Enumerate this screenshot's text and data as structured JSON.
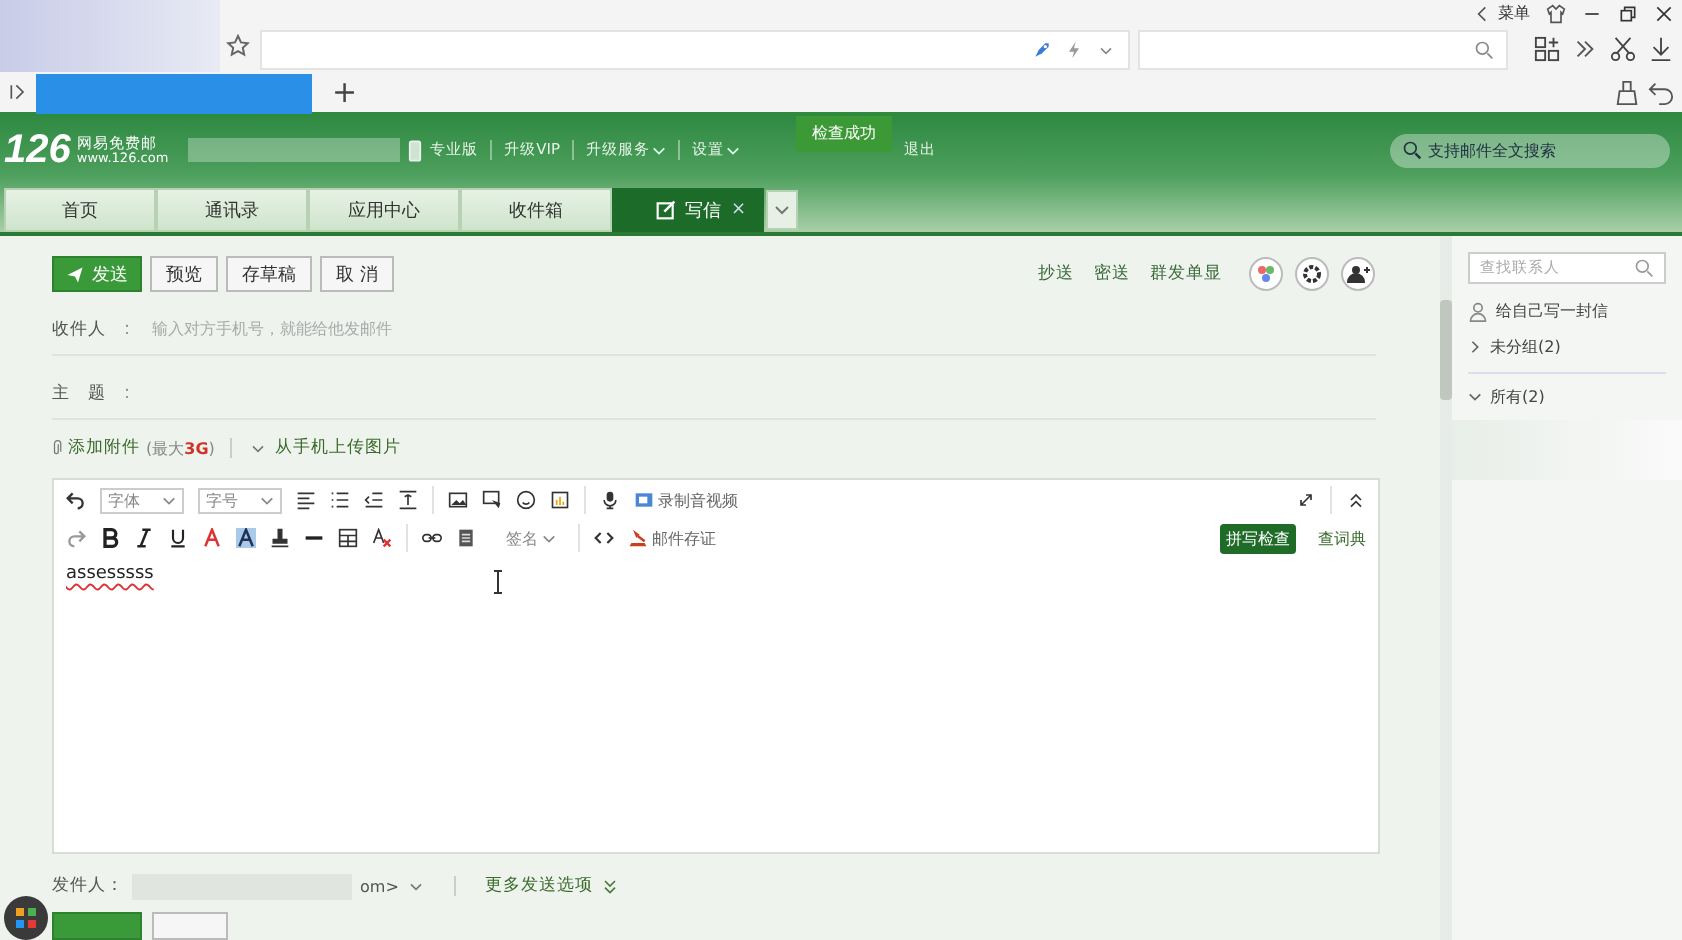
{
  "browser": {
    "menu_label": "菜单",
    "new_tab": "+"
  },
  "header": {
    "logo": {
      "number": "126",
      "name": "网易免费邮",
      "domain": "www.126.com"
    },
    "links": [
      {
        "label": "专业版",
        "dropdown": false
      },
      {
        "label": "升级VIP",
        "dropdown": false
      },
      {
        "label": "升级服务",
        "dropdown": true
      },
      {
        "label": "设置",
        "dropdown": true
      },
      {
        "label": "退出",
        "dropdown": false
      }
    ],
    "toast": "检查成功",
    "search": {
      "placeholder": "支持邮件全文搜索"
    }
  },
  "nav_tabs": [
    {
      "label": "首页",
      "selected": false,
      "kind": "plain"
    },
    {
      "label": "通讯录",
      "selected": false,
      "kind": "plain"
    },
    {
      "label": "应用中心",
      "selected": false,
      "kind": "plain"
    },
    {
      "label": "收件箱",
      "selected": false,
      "kind": "plain"
    },
    {
      "label": "写信",
      "selected": true,
      "kind": "compose",
      "close": "×"
    }
  ],
  "compose": {
    "actions": [
      {
        "label": "发送",
        "kind": "primary"
      },
      {
        "label": "预览",
        "kind": "plain"
      },
      {
        "label": "存草稿",
        "kind": "plain"
      },
      {
        "label": "取 消",
        "kind": "plain"
      }
    ],
    "header_links": [
      "抄送",
      "密送",
      "群发单显"
    ],
    "fields": [
      {
        "label": "收件人",
        "colon": "：",
        "placeholder": "输入对方手机号，就能给他发邮件"
      },
      {
        "label": "主　题",
        "colon": "："
      }
    ],
    "attach": {
      "label": "添加附件",
      "limit": "(最大**3G**)",
      "phone_upload": "从手机上传图片"
    },
    "editor": {
      "font": "字体",
      "size": "字号",
      "signature": "签名",
      "record": "录制音视频",
      "proof": "邮件存证",
      "spellcheck": "拼写检查",
      "dictionary": "查词典",
      "body": "assesssss"
    },
    "sender": {
      "label": "发件人：",
      "address": "om>",
      "more": "更多发送选项"
    }
  },
  "sidebar": {
    "search": {
      "placeholder": "查找联系人"
    },
    "write_self": "给自己写一封信",
    "groups": [
      {
        "label": "未分组(2)",
        "expanded": false
      },
      {
        "label": "所有(2)",
        "expanded": true
      }
    ]
  }
}
